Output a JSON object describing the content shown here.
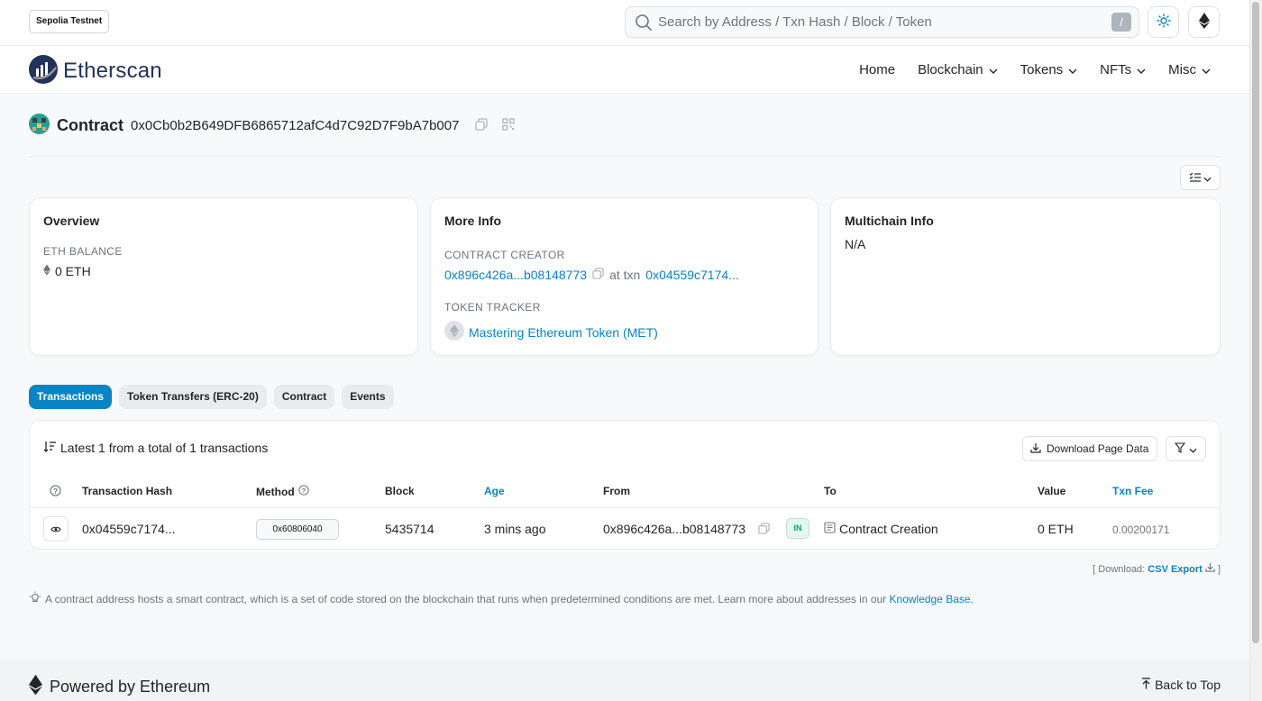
{
  "network_badge": "Sepolia Testnet",
  "search": {
    "placeholder": "Search by Address / Txn Hash / Block / Token",
    "shortcut": "/"
  },
  "brand": {
    "name": "Etherscan"
  },
  "nav": [
    "Home",
    "Blockchain",
    "Tokens",
    "NFTs",
    "Misc"
  ],
  "contract": {
    "title": "Contract",
    "address": "0x0Cb0b2B649DFB6865712afC4d7C92D7F9bA7b007"
  },
  "overview": {
    "title": "Overview",
    "balance_label": "ETH BALANCE",
    "balance_value": "0 ETH"
  },
  "more_info": {
    "title": "More Info",
    "creator_label": "CONTRACT CREATOR",
    "creator_address": "0x896c426a...b08148773",
    "at_txn_text": "at txn",
    "creator_txn": "0x04559c7174...",
    "token_tracker_label": "TOKEN TRACKER",
    "token_tracker_name": "Mastering Ethereum Token (MET)"
  },
  "multichain": {
    "title": "Multichain Info",
    "value": "N/A"
  },
  "tabs": [
    "Transactions",
    "Token Transfers (ERC-20)",
    "Contract",
    "Events"
  ],
  "transactions": {
    "summary": "Latest 1 from a total of 1 transactions",
    "download_label": "Download Page Data",
    "columns": [
      "Transaction Hash",
      "Method",
      "Block",
      "Age",
      "From",
      "To",
      "Value",
      "Txn Fee"
    ],
    "rows": [
      {
        "hash": "0x04559c7174...",
        "method": "0x60806040",
        "block": "5435714",
        "age": "3 mins ago",
        "from": "0x896c426a...b08148773",
        "direction": "IN",
        "to": "Contract Creation",
        "value": "0 ETH",
        "fee": "0.00200171"
      }
    ]
  },
  "csv": {
    "prefix": "[ Download:",
    "link": "CSV Export",
    "suffix": "]"
  },
  "info_note": {
    "text": "A contract address hosts a smart contract, which is a set of code stored on the blockchain that runs when predetermined conditions are met. Learn more about addresses in our",
    "link": "Knowledge Base",
    "end": "."
  },
  "footer": {
    "powered": "Powered by Ethereum",
    "back_to_top": "Back to Top"
  },
  "colors": {
    "brand_blue": "#0784c3",
    "logo_navy": "#21325b",
    "in_green": "#00a186"
  }
}
